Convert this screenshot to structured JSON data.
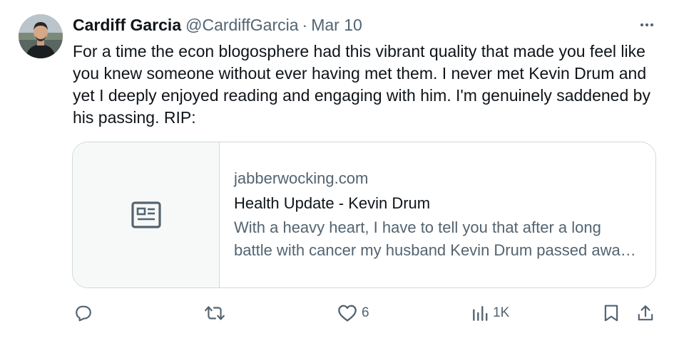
{
  "tweet": {
    "author_name": "Cardiff Garcia",
    "author_handle": "@CardiffGarcia",
    "separator": "·",
    "date": "Mar 10",
    "text": "For a time the econ blogosphere had this vibrant quality that made you feel like you knew someone without ever having met them. I never met Kevin Drum and yet I deeply enjoyed reading and engaging with him. I'm genuinely saddened by his passing. RIP:"
  },
  "link_card": {
    "domain": "jabberwocking.com",
    "title": "Health Update - Kevin Drum",
    "description": "With a heavy heart, I have to tell you that after a long battle with cancer my husband Kevin Drum passed away peacefully",
    "thumbnail_icon": "article-icon"
  },
  "actions": {
    "reply": {
      "icon": "reply-icon",
      "count": ""
    },
    "retweet": {
      "icon": "retweet-icon",
      "count": ""
    },
    "like": {
      "icon": "heart-icon",
      "count": "6"
    },
    "views": {
      "icon": "analytics-icon",
      "count": "1K"
    },
    "bookmark": {
      "icon": "bookmark-icon"
    },
    "share": {
      "icon": "share-icon"
    }
  },
  "colors": {
    "text_primary": "#0f1419",
    "text_secondary": "#536471",
    "border": "#cfd9de",
    "card_thumb_bg": "#f7f9f9"
  }
}
